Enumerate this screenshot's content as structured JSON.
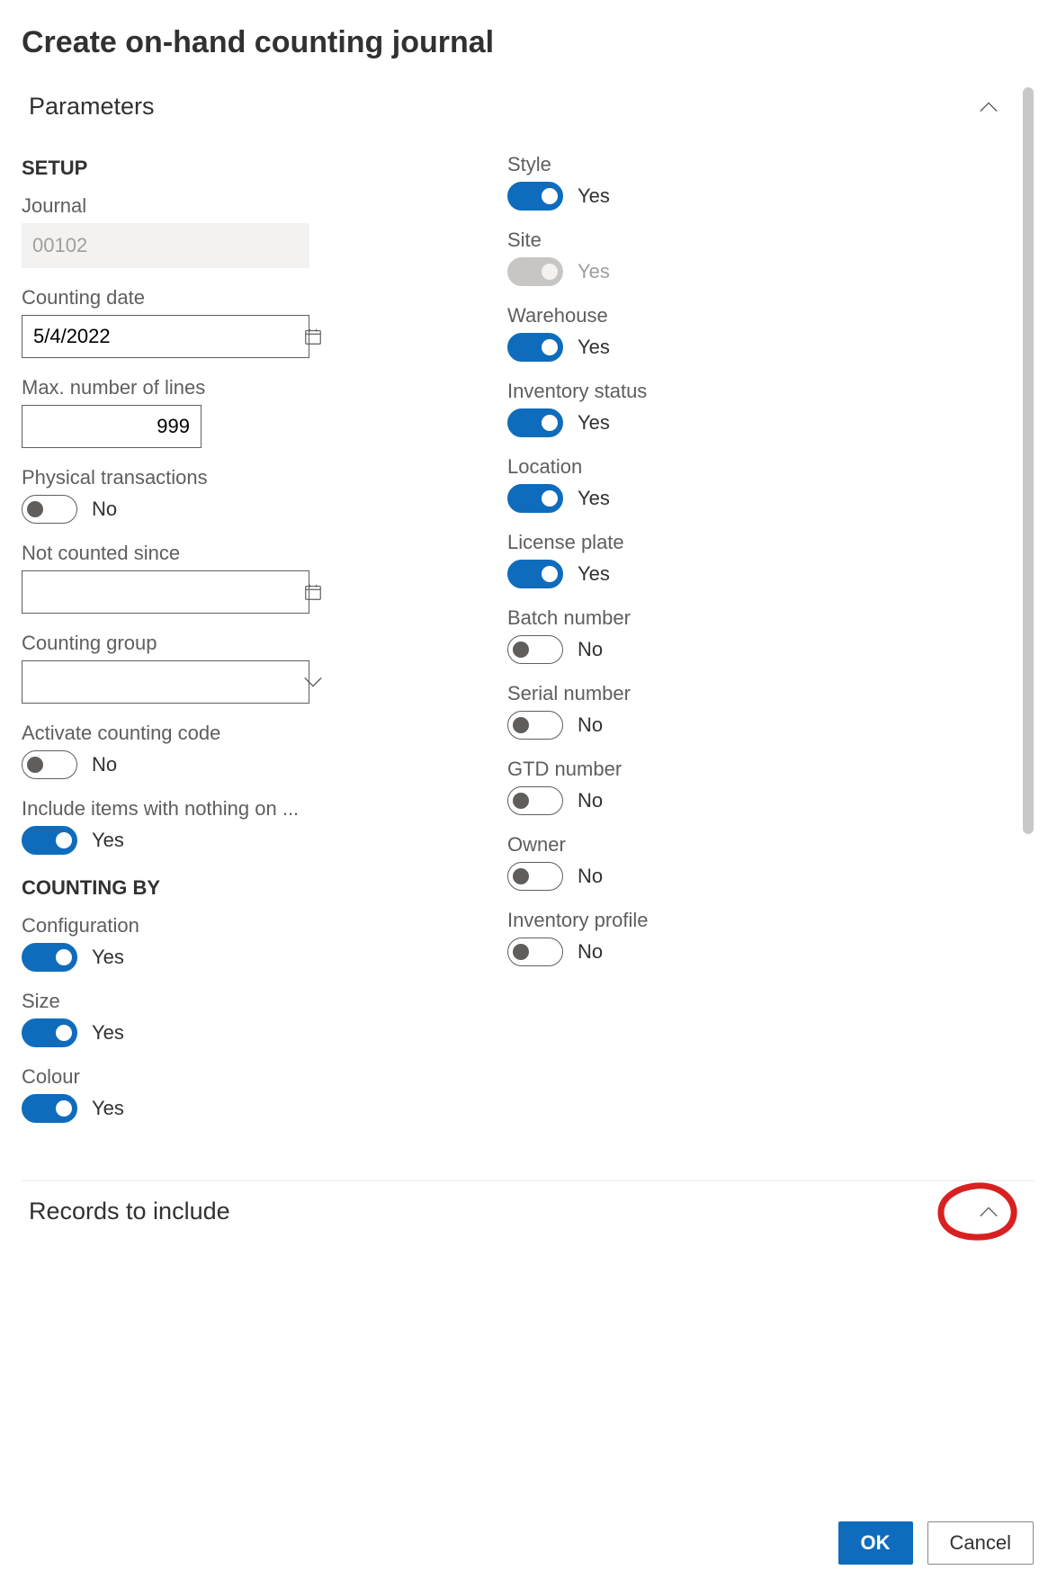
{
  "dialog": {
    "title": "Create on-hand counting journal"
  },
  "sections": {
    "parameters": "Parameters",
    "records": "Records to include"
  },
  "headings": {
    "setup": "SETUP",
    "counting_by": "COUNTING BY"
  },
  "setup": {
    "journal_label": "Journal",
    "journal_value": "00102",
    "counting_date_label": "Counting date",
    "counting_date_value": "5/4/2022",
    "max_lines_label": "Max. number of lines",
    "max_lines_value": "999",
    "physical_trans_label": "Physical transactions",
    "physical_trans_text": "No",
    "not_counted_label": "Not counted since",
    "not_counted_value": "",
    "counting_group_label": "Counting group",
    "counting_group_value": "",
    "activate_code_label": "Activate counting code",
    "activate_code_text": "No",
    "include_items_label": "Include items with nothing on ...",
    "include_items_text": "Yes"
  },
  "counting_by": {
    "configuration_label": "Configuration",
    "configuration_text": "Yes",
    "size_label": "Size",
    "size_text": "Yes",
    "colour_label": "Colour",
    "colour_text": "Yes",
    "style_label": "Style",
    "style_text": "Yes",
    "site_label": "Site",
    "site_text": "Yes",
    "warehouse_label": "Warehouse",
    "warehouse_text": "Yes",
    "inventory_status_label": "Inventory status",
    "inventory_status_text": "Yes",
    "location_label": "Location",
    "location_text": "Yes",
    "license_plate_label": "License plate",
    "license_plate_text": "Yes",
    "batch_number_label": "Batch number",
    "batch_number_text": "No",
    "serial_number_label": "Serial number",
    "serial_number_text": "No",
    "gtd_number_label": "GTD number",
    "gtd_number_text": "No",
    "owner_label": "Owner",
    "owner_text": "No",
    "inventory_profile_label": "Inventory profile",
    "inventory_profile_text": "No"
  },
  "footer": {
    "ok": "OK",
    "cancel": "Cancel"
  }
}
